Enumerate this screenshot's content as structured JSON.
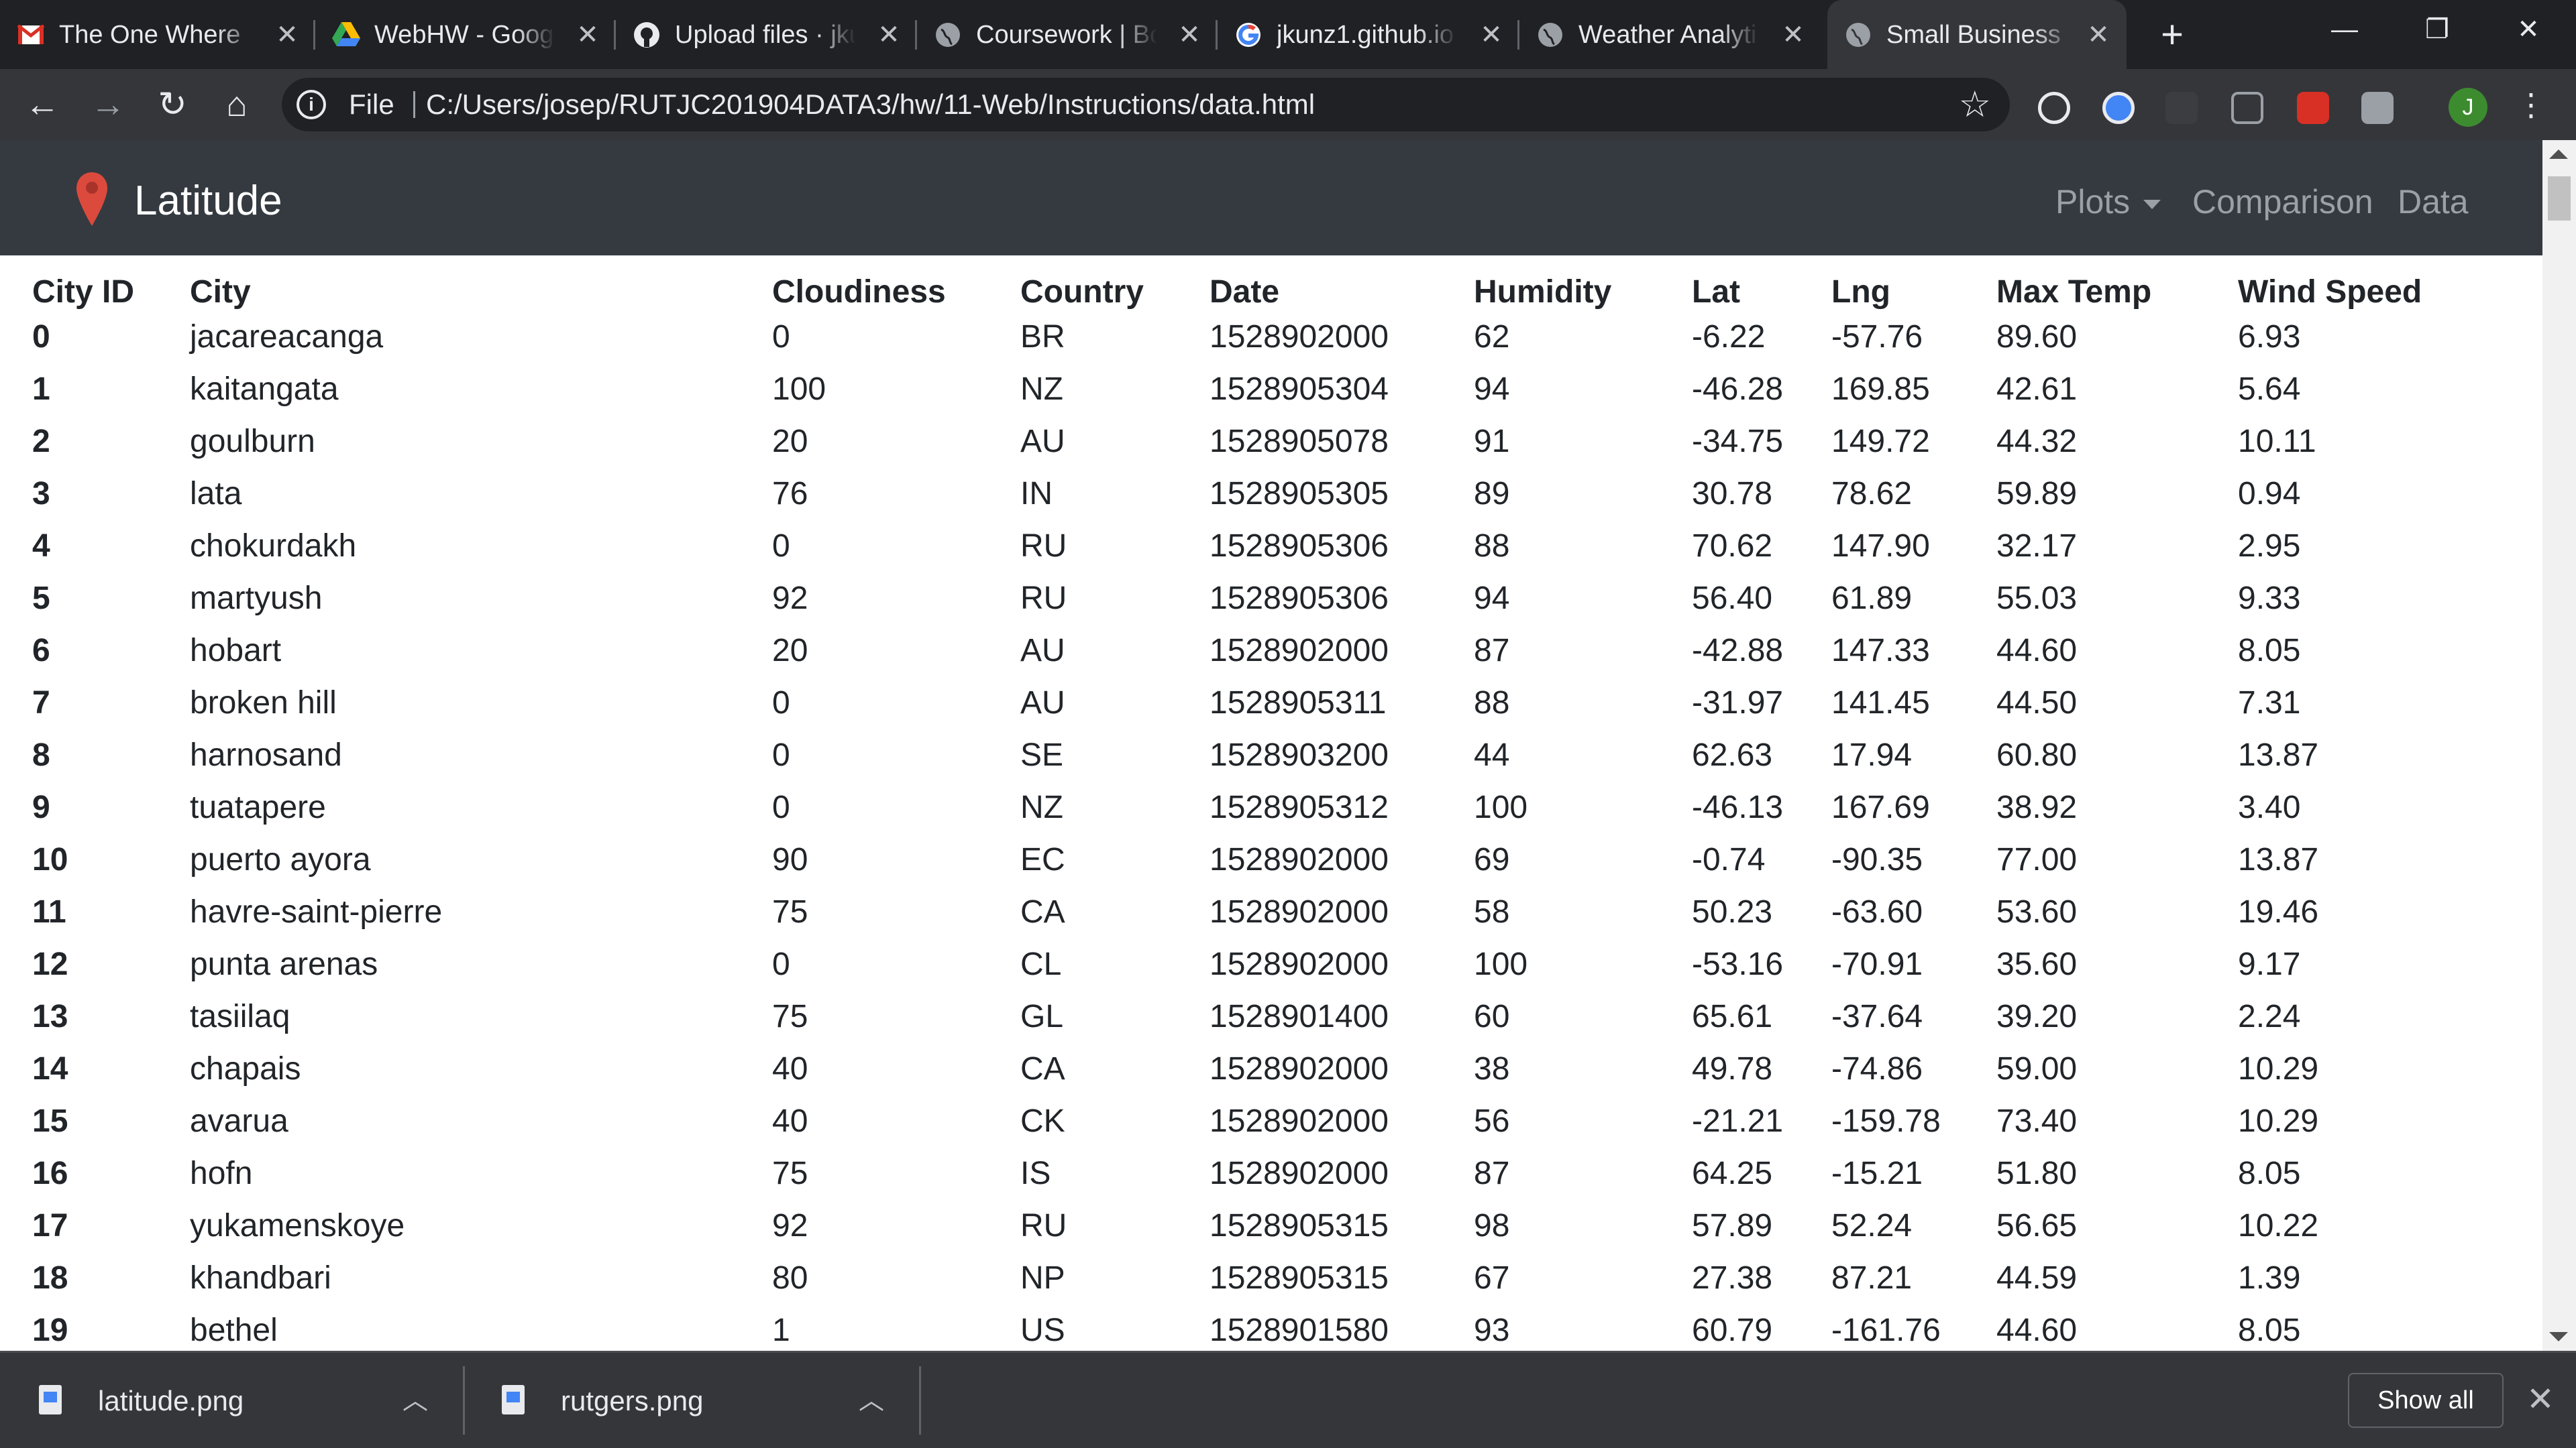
{
  "tabs": [
    {
      "title": "The One Where",
      "icon": "gmail-icon"
    },
    {
      "title": "WebHW - Goog",
      "icon": "google-drive-icon"
    },
    {
      "title": "Upload files · jku",
      "icon": "github-icon"
    },
    {
      "title": "Coursework | Bo",
      "icon": "globe-icon"
    },
    {
      "title": "jkunz1.github.io",
      "icon": "google-icon"
    },
    {
      "title": "Weather Analyti",
      "icon": "globe-icon"
    },
    {
      "title": "Small Business",
      "icon": "globe-icon"
    }
  ],
  "toolbar": {
    "scheme": "File",
    "url": "C:/Users/josep/RUTJC201904DATA3/hw/11-Web/Instructions/data.html",
    "profile_initial": "J"
  },
  "nav": {
    "brand": "Latitude",
    "plots": "Plots",
    "comparison": "Comparison",
    "data": "Data"
  },
  "table": {
    "headers": [
      "City ID",
      "City",
      "Cloudiness",
      "Country",
      "Date",
      "Humidity",
      "Lat",
      "Lng",
      "Max Temp",
      "Wind Speed"
    ],
    "rows": [
      [
        "0",
        "jacareacanga",
        "0",
        "BR",
        "1528902000",
        "62",
        "-6.22",
        "-57.76",
        "89.60",
        "6.93"
      ],
      [
        "1",
        "kaitangata",
        "100",
        "NZ",
        "1528905304",
        "94",
        "-46.28",
        "169.85",
        "42.61",
        "5.64"
      ],
      [
        "2",
        "goulburn",
        "20",
        "AU",
        "1528905078",
        "91",
        "-34.75",
        "149.72",
        "44.32",
        "10.11"
      ],
      [
        "3",
        "lata",
        "76",
        "IN",
        "1528905305",
        "89",
        "30.78",
        "78.62",
        "59.89",
        "0.94"
      ],
      [
        "4",
        "chokurdakh",
        "0",
        "RU",
        "1528905306",
        "88",
        "70.62",
        "147.90",
        "32.17",
        "2.95"
      ],
      [
        "5",
        "martyush",
        "92",
        "RU",
        "1528905306",
        "94",
        "56.40",
        "61.89",
        "55.03",
        "9.33"
      ],
      [
        "6",
        "hobart",
        "20",
        "AU",
        "1528902000",
        "87",
        "-42.88",
        "147.33",
        "44.60",
        "8.05"
      ],
      [
        "7",
        "broken hill",
        "0",
        "AU",
        "1528905311",
        "88",
        "-31.97",
        "141.45",
        "44.50",
        "7.31"
      ],
      [
        "8",
        "harnosand",
        "0",
        "SE",
        "1528903200",
        "44",
        "62.63",
        "17.94",
        "60.80",
        "13.87"
      ],
      [
        "9",
        "tuatapere",
        "0",
        "NZ",
        "1528905312",
        "100",
        "-46.13",
        "167.69",
        "38.92",
        "3.40"
      ],
      [
        "10",
        "puerto ayora",
        "90",
        "EC",
        "1528902000",
        "69",
        "-0.74",
        "-90.35",
        "77.00",
        "13.87"
      ],
      [
        "11",
        "havre-saint-pierre",
        "75",
        "CA",
        "1528902000",
        "58",
        "50.23",
        "-63.60",
        "53.60",
        "19.46"
      ],
      [
        "12",
        "punta arenas",
        "0",
        "CL",
        "1528902000",
        "100",
        "-53.16",
        "-70.91",
        "35.60",
        "9.17"
      ],
      [
        "13",
        "tasiilaq",
        "75",
        "GL",
        "1528901400",
        "60",
        "65.61",
        "-37.64",
        "39.20",
        "2.24"
      ],
      [
        "14",
        "chapais",
        "40",
        "CA",
        "1528902000",
        "38",
        "49.78",
        "-74.86",
        "59.00",
        "10.29"
      ],
      [
        "15",
        "avarua",
        "40",
        "CK",
        "1528902000",
        "56",
        "-21.21",
        "-159.78",
        "73.40",
        "10.29"
      ],
      [
        "16",
        "hofn",
        "75",
        "IS",
        "1528902000",
        "87",
        "64.25",
        "-15.21",
        "51.80",
        "8.05"
      ],
      [
        "17",
        "yukamenskoye",
        "92",
        "RU",
        "1528905315",
        "98",
        "57.89",
        "52.24",
        "56.65",
        "10.22"
      ],
      [
        "18",
        "khandbari",
        "80",
        "NP",
        "1528905315",
        "67",
        "27.38",
        "87.21",
        "44.59",
        "1.39"
      ],
      [
        "19",
        "bethel",
        "1",
        "US",
        "1528901580",
        "93",
        "60.79",
        "-161.76",
        "44.60",
        "8.05"
      ]
    ]
  },
  "downloads": {
    "items": [
      {
        "name": "latitude.png"
      },
      {
        "name": "rutgers.png"
      }
    ],
    "show_all": "Show all"
  },
  "colors": {
    "browser_frame": "#202124",
    "toolbar": "#35363a",
    "navbar": "#343a40",
    "pin": "#dc4a3d",
    "profile": "#3c8c2f"
  }
}
